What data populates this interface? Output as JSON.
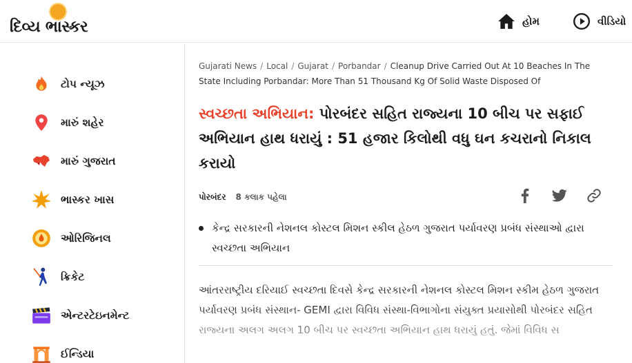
{
  "brand": {
    "name": "દિવ્ય ભાસ્કર",
    "accent": "#f5a623"
  },
  "header": {
    "nav": [
      {
        "label": "હોમ",
        "icon": "home-icon"
      },
      {
        "label": "વીડિયો",
        "icon": "play-circle-icon"
      }
    ]
  },
  "sidebar": {
    "items": [
      {
        "label": "ટોપ ન્યૂઝ",
        "icon": "flame-icon"
      },
      {
        "label": "મારું શહેર",
        "icon": "location-pin-icon"
      },
      {
        "label": "મારું ગુજરાત",
        "icon": "gujarat-map-icon"
      },
      {
        "label": "ભાસ્કર ખાસ",
        "icon": "star-burst-icon"
      },
      {
        "label": "ઓરિજિનલ",
        "icon": "original-badge-icon"
      },
      {
        "label": "ક્રિકેટ",
        "icon": "cricket-player-icon"
      },
      {
        "label": "એન્ટરટેઇનમેન્ટ",
        "icon": "clapperboard-icon"
      },
      {
        "label": "ઈન્ડિયા",
        "icon": "india-gate-icon"
      }
    ]
  },
  "article": {
    "breadcrumb": {
      "items": [
        "Gujarati News",
        "Local",
        "Gujarat",
        "Porbandar"
      ],
      "current": "Cleanup Drive Carried Out At 10 Beaches In The State Including Porbandar: More Than 51 Thousand Kg Of Solid Waste Disposed Of"
    },
    "headline_tag": "સ્વચ્છતા અભિયાન:",
    "headline": " પોરબંદર સહિત રાજ્યના 10 બીચ પર સફાઈ અભિયાન હાથ ધરાયું : 51 હજાર કિલોથી વધુ ઘન કચરાનો નિકાલ કરાયો",
    "location": "પોરબંદર",
    "time": "8 કલાક પહેલા",
    "share": [
      {
        "icon": "facebook-icon"
      },
      {
        "icon": "twitter-icon"
      },
      {
        "icon": "link-icon"
      }
    ],
    "bullet": "કેન્દ્ર સરકારની નેશનલ કોસ્ટલ મિશન સ્કીલ હેઠળ ગુજરાત પર્યાવરણ પ્રબંધ સંસ્થાઓ દ્વારા સ્વચ્છતા અભિયાન",
    "body": "આંતરરાષ્ટ્રીય દરિયાઈ સ્વચ્છતા દિવસે કેન્દ્ર સરકારની નેશનલ કોસ્ટલ મિશન સ્કીમ હેઠળ ગુજરાત પર્યાવરણ પ્રબંધ સંસ્થાન- GEMI દ્વારા વિવિધ સંસ્થા-વિભાગોના સંયુક્ત પ્રયાસોથી પોરબંદર સહિત રાજ્યના અલગ અલગ 10 બીચ પર સ્વચ્છતા અભિયાન હાથ ધરાયું હતું. જેમાં વિવિધ સ"
  }
}
